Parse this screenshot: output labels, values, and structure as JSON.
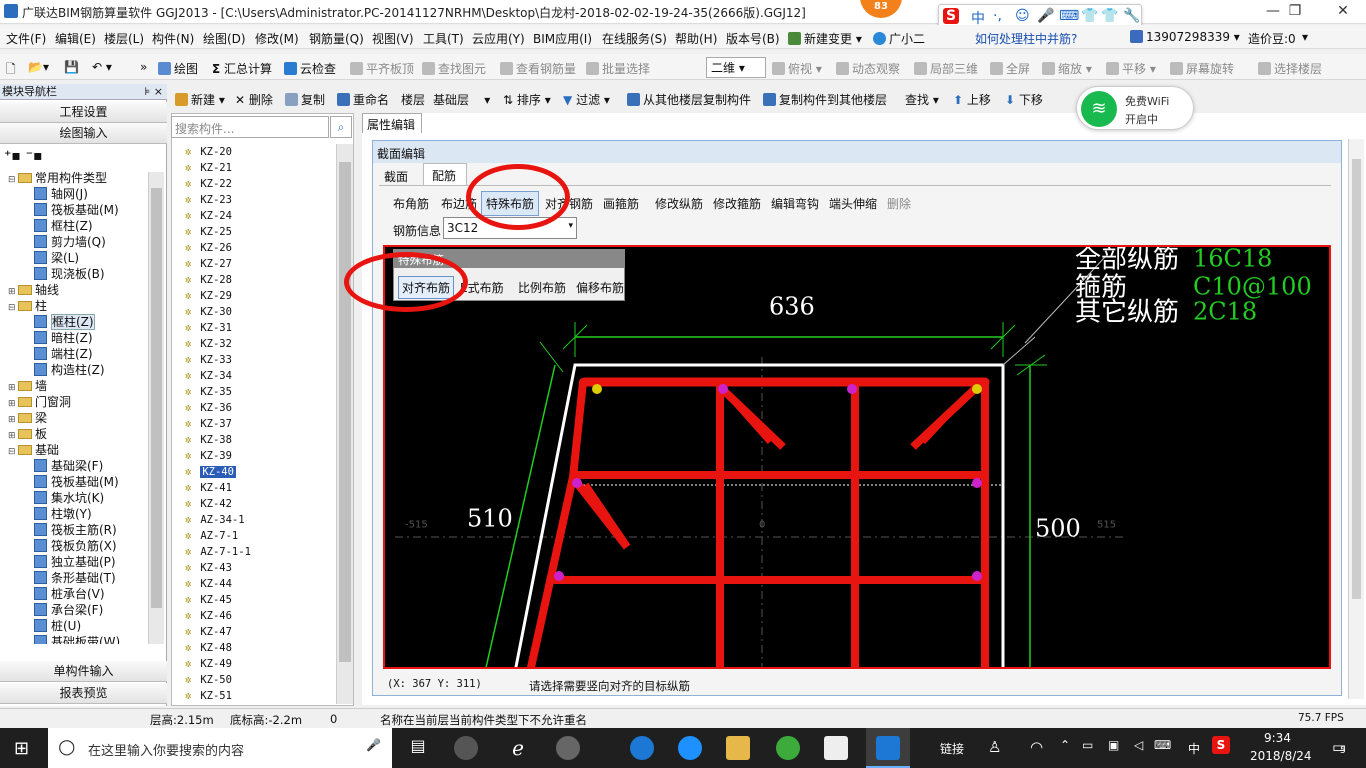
{
  "titlebar": {
    "title": "广联达BIM钢筋算量软件 GGJ2013 - [C:\\Users\\Administrator.PC-20141127NRHM\\Desktop\\白龙村-2018-02-02-19-24-35(2666版).GGJ12]",
    "badge": "83",
    "minimize": "—",
    "restore": "❐",
    "close": "✕",
    "ime": [
      "S",
      "中",
      "·,",
      "☺",
      "🎤",
      "⌨",
      "👕",
      "👕",
      "🔧"
    ]
  },
  "menu": {
    "items": [
      "文件(F)",
      "编辑(E)",
      "楼层(L)",
      "构件(N)",
      "绘图(D)",
      "修改(M)",
      "钢筋量(Q)",
      "视图(V)",
      "工具(T)",
      "云应用(Y)",
      "BIM应用(I)",
      "在线服务(S)",
      "帮助(H)",
      "版本号(B)",
      "新建变更",
      "广小二",
      "如何处理柱中并筋?",
      "13907298339",
      "造价豆:0"
    ]
  },
  "toolbar1": {
    "items": [
      "绘图",
      "汇总计算",
      "云检查",
      "平齐板顶",
      "查找图元",
      "查看钢筋量",
      "批量选择",
      "二维",
      "俯视",
      "动态观察",
      "局部三维",
      "全屏",
      "缩放",
      "平移",
      "屏幕旋转",
      "选择楼层"
    ]
  },
  "toolbar2": {
    "items": [
      "新建",
      "删除",
      "复制",
      "重命名",
      "楼层",
      "基础层",
      "排序",
      "过滤",
      "从其他楼层复制构件",
      "复制构件到其他楼层",
      "查找",
      "上移",
      "下移"
    ]
  },
  "nav": {
    "header": "模块导航栏",
    "pin": "⊧ ×",
    "btn_settings": "工程设置",
    "btn_drawing": "绘图输入",
    "btn_single": "单构件输入",
    "btn_report": "报表预览",
    "tree": [
      {
        "l": "常用构件类型",
        "lvl": 1,
        "t": "f",
        "e": "⊟"
      },
      {
        "l": "轴网(J)",
        "lvl": 2,
        "t": "c"
      },
      {
        "l": "筏板基础(M)",
        "lvl": 2,
        "t": "c"
      },
      {
        "l": "框柱(Z)",
        "lvl": 2,
        "t": "c"
      },
      {
        "l": "剪力墙(Q)",
        "lvl": 2,
        "t": "c"
      },
      {
        "l": "梁(L)",
        "lvl": 2,
        "t": "c"
      },
      {
        "l": "现浇板(B)",
        "lvl": 2,
        "t": "c"
      },
      {
        "l": "轴线",
        "lvl": 1,
        "t": "f",
        "e": "⊞"
      },
      {
        "l": "柱",
        "lvl": 1,
        "t": "f",
        "e": "⊟"
      },
      {
        "l": "框柱(Z)",
        "lvl": 2,
        "t": "c",
        "s": true
      },
      {
        "l": "暗柱(Z)",
        "lvl": 2,
        "t": "c"
      },
      {
        "l": "端柱(Z)",
        "lvl": 2,
        "t": "c"
      },
      {
        "l": "构造柱(Z)",
        "lvl": 2,
        "t": "c"
      },
      {
        "l": "墙",
        "lvl": 1,
        "t": "f",
        "e": "⊞"
      },
      {
        "l": "门窗洞",
        "lvl": 1,
        "t": "f",
        "e": "⊞"
      },
      {
        "l": "梁",
        "lvl": 1,
        "t": "f",
        "e": "⊞"
      },
      {
        "l": "板",
        "lvl": 1,
        "t": "f",
        "e": "⊞"
      },
      {
        "l": "基础",
        "lvl": 1,
        "t": "f",
        "e": "⊟"
      },
      {
        "l": "基础梁(F)",
        "lvl": 2,
        "t": "c"
      },
      {
        "l": "筏板基础(M)",
        "lvl": 2,
        "t": "c"
      },
      {
        "l": "集水坑(K)",
        "lvl": 2,
        "t": "c"
      },
      {
        "l": "柱墩(Y)",
        "lvl": 2,
        "t": "c"
      },
      {
        "l": "筏板主筋(R)",
        "lvl": 2,
        "t": "c"
      },
      {
        "l": "筏板负筋(X)",
        "lvl": 2,
        "t": "c"
      },
      {
        "l": "独立基础(P)",
        "lvl": 2,
        "t": "c"
      },
      {
        "l": "条形基础(T)",
        "lvl": 2,
        "t": "c"
      },
      {
        "l": "桩承台(V)",
        "lvl": 2,
        "t": "c"
      },
      {
        "l": "承台梁(F)",
        "lvl": 2,
        "t": "c"
      },
      {
        "l": "桩(U)",
        "lvl": 2,
        "t": "c"
      },
      {
        "l": "基础板带(W)",
        "lvl": 2,
        "t": "c"
      }
    ]
  },
  "complist": {
    "search_placeholder": "搜索构件...",
    "items": [
      "KZ-20",
      "KZ-21",
      "KZ-22",
      "KZ-23",
      "KZ-24",
      "KZ-25",
      "KZ-26",
      "KZ-27",
      "KZ-28",
      "KZ-29",
      "KZ-30",
      "KZ-31",
      "KZ-32",
      "KZ-33",
      "KZ-34",
      "KZ-35",
      "KZ-36",
      "KZ-37",
      "KZ-38",
      "KZ-39",
      "KZ-40",
      "KZ-41",
      "KZ-42",
      "AZ-34-1",
      "AZ-7-1",
      "AZ-7-1-1",
      "KZ-43",
      "KZ-44",
      "KZ-45",
      "KZ-46",
      "KZ-47",
      "KZ-48",
      "KZ-49",
      "KZ-50",
      "KZ-51"
    ],
    "selected": "KZ-40"
  },
  "props_tab": "属性编辑",
  "dialog": {
    "title": "截面编辑",
    "tab_section": "截面",
    "tab_rebar": "配筋",
    "tools": [
      "布角筋",
      "布边筋",
      "特殊布筋",
      "对齐钢筋",
      "画箍筋",
      "修改纵筋",
      "修改箍筋",
      "编辑弯钩",
      "端头伸缩",
      "删除"
    ],
    "rebar_info_label": "钢筋信息",
    "rebar_info_value": "3C12",
    "popup_title": "特殊布筋",
    "popup_items": [
      "对齐布筋",
      "E式布筋",
      "比例布筋",
      "偏移布筋"
    ],
    "status_coords": "(X: 367 Y: 311)",
    "status_msg": "请选择需要竖向对齐的目标纵筋"
  },
  "canvas": {
    "dim_top": "636",
    "dim_left": "510",
    "dim_right": "500",
    "axis_left": "-515",
    "axis_zero": "0",
    "axis_right": "515",
    "legend": [
      {
        "label": "全部纵筋",
        "value": "16C18"
      },
      {
        "label": "箍筋",
        "value": "C10@100"
      },
      {
        "label": "其它纵筋",
        "value": "2C18"
      }
    ]
  },
  "statusbar": {
    "floor_height": "层高:2.15m",
    "floor_bottom": "底标高:-2.2m",
    "zero": "0",
    "message": "名称在当前层当前构件类型下不允许重名",
    "fps": "75.7 FPS"
  },
  "wifi": {
    "line1": "免费WiFi",
    "line2": "开启中"
  },
  "taskbar": {
    "search": "在这里输入你要搜索的内容",
    "link": "链接",
    "ime": "中",
    "time": "9:34",
    "date": "2018/8/24",
    "notif": "5"
  },
  "colors": {
    "rebar": "#e8140f",
    "highlight_ring": "#e8140f",
    "canvas_bg": "#000000",
    "legend_text": "#ffffff",
    "legend_value": "#22cc22",
    "dim_line": "#22cc22"
  }
}
